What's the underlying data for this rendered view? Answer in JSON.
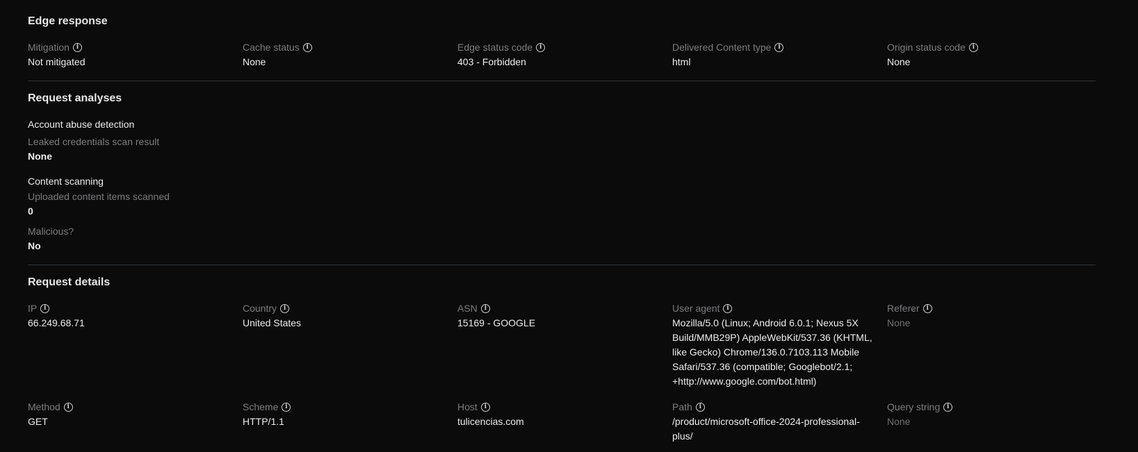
{
  "edge_response": {
    "title": "Edge response",
    "fields": [
      {
        "label": "Mitigation",
        "value": "Not mitigated"
      },
      {
        "label": "Cache status",
        "value": "None"
      },
      {
        "label": "Edge status code",
        "value": "403 - Forbidden"
      },
      {
        "label": "Delivered Content type",
        "value": "html"
      },
      {
        "label": "Origin status code",
        "value": "None"
      }
    ]
  },
  "request_analyses": {
    "title": "Request analyses",
    "account_abuse": {
      "heading": "Account abuse detection",
      "label": "Leaked credentials scan result",
      "value": "None"
    },
    "content_scanning": {
      "heading": "Content scanning",
      "items_label": "Uploaded content items scanned",
      "items_value": "0",
      "malicious_label": "Malicious?",
      "malicious_value": "No"
    }
  },
  "request_details": {
    "title": "Request details",
    "row1": [
      {
        "label": "IP",
        "value": "66.249.68.71"
      },
      {
        "label": "Country",
        "value": "United States"
      },
      {
        "label": "ASN",
        "value": "15169 - GOOGLE"
      },
      {
        "label": "User agent",
        "value": "Mozilla/5.0 (Linux; Android 6.0.1; Nexus 5X Build/MMB29P) AppleWebKit/537.36 (KHTML, like Gecko) Chrome/136.0.7103.113 Mobile Safari/537.36 (compatible; Googlebot/2.1; +http://www.google.com/bot.html)"
      },
      {
        "label": "Referer",
        "value": "None"
      }
    ],
    "row2": [
      {
        "label": "Method",
        "value": "GET"
      },
      {
        "label": "Scheme",
        "value": "HTTP/1.1"
      },
      {
        "label": "Host",
        "value": "tulicencias.com"
      },
      {
        "label": "Path",
        "value": "/product/microsoft-office-2024-professional-plus/"
      },
      {
        "label": "Query string",
        "value": "None"
      }
    ]
  },
  "icons": {
    "info": "info-circle-icon"
  },
  "colors": {
    "background": "#0b0b0c",
    "label": "#7c7c7e",
    "value": "#ececec",
    "muted_value": "#6f6f71",
    "divider": "#333436"
  }
}
